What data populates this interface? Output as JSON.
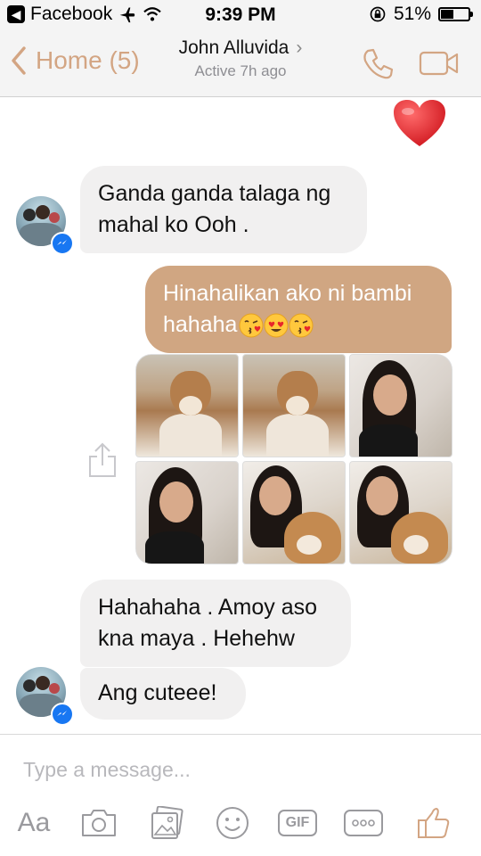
{
  "status_bar": {
    "back_app": "Facebook",
    "time": "9:39 PM",
    "battery": "51%",
    "battery_level": 0.51
  },
  "nav": {
    "back_label": "Home (5)",
    "contact_name": "John Alluvida",
    "status": "Active 7h ago"
  },
  "messages": [
    {
      "direction": "incoming",
      "text_lines": [
        "Ganda ganda talaga ng",
        "mahal ko Ooh ."
      ]
    },
    {
      "direction": "outgoing",
      "text_lines": [
        "Hinahalikan ako ni bambi",
        "hahaha"
      ],
      "emojis": [
        "face-blowing-kiss",
        "heart-eyes",
        "face-blowing-kiss"
      ]
    },
    {
      "direction": "outgoing",
      "type": "photo-grid",
      "photo_count": 6
    },
    {
      "direction": "incoming",
      "text_lines": [
        "Hahahaha . Amoy aso",
        "kna maya . Hehehw"
      ]
    },
    {
      "direction": "incoming",
      "text_lines": [
        "Ang cuteee!"
      ]
    }
  ],
  "composer": {
    "placeholder": "Type a message...",
    "aa_label": "Aa",
    "gif_label": "GIF"
  },
  "colors": {
    "accent": "#d3a583",
    "outgoing_bubble": "#d0a682",
    "incoming_bubble": "#f1f0f0",
    "heart": "#e8262a"
  },
  "icons": [
    "phone-icon",
    "video-camera-icon",
    "heart-icon",
    "share-icon",
    "camera-icon",
    "gallery-icon",
    "emoji-icon",
    "gif-icon",
    "more-icon",
    "thumbs-up-icon",
    "messenger-badge-icon"
  ]
}
